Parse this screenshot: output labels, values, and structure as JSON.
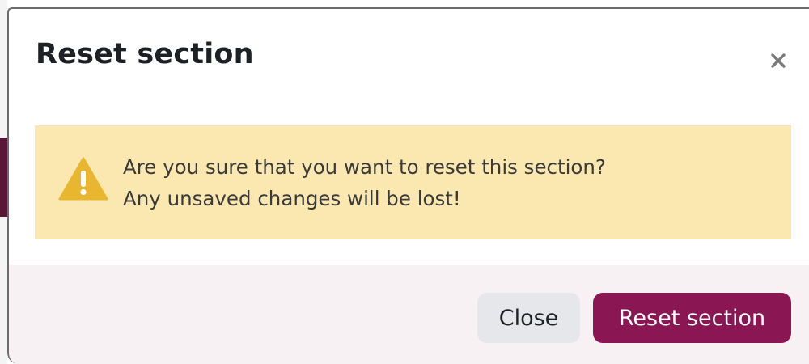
{
  "dialog": {
    "title": "Reset section",
    "close_icon": "close-x-icon",
    "alert": {
      "icon": "warning-triangle-icon",
      "line1": "Are you sure that you want to reset this section?",
      "line2": "Any unsaved changes will be lost!",
      "background_color": "#fbe8b1",
      "icon_color": "#e8b72f"
    },
    "buttons": {
      "close_label": "Close",
      "reset_label": "Reset section"
    },
    "colors": {
      "primary": "#8a1754",
      "secondary": "#e5e7ea",
      "footer_background": "#f8f1f3"
    }
  }
}
